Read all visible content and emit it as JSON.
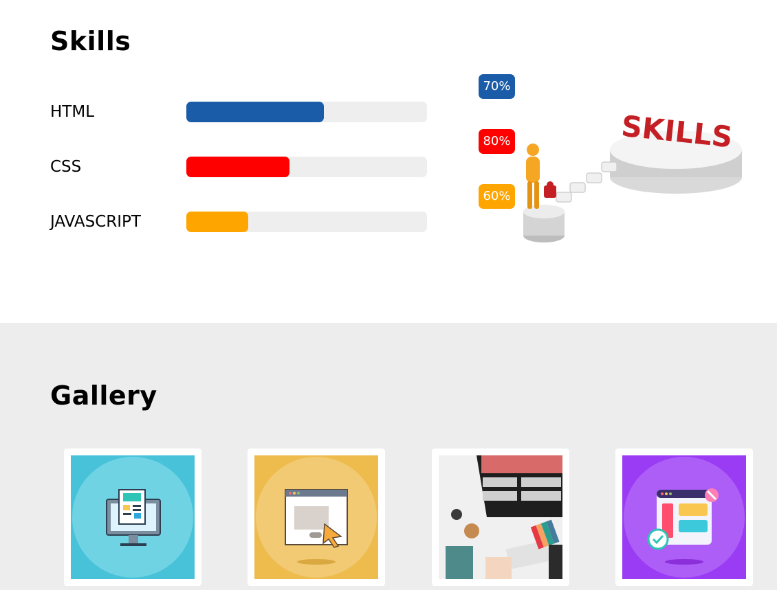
{
  "skills": {
    "title": "Skills",
    "items": [
      {
        "label": "HTML",
        "percent_label": "70%",
        "percent": 70,
        "color": "#1a5ca8"
      },
      {
        "label": "CSS",
        "percent_label": "80%",
        "percent": 80,
        "color": "#ff0000"
      },
      {
        "label": "JAVASCRIPT",
        "percent_label": "60%",
        "percent": 60,
        "color": "#ffa500"
      }
    ],
    "illustration_text": "SKILLS"
  },
  "gallery": {
    "title": "Gallery",
    "items": [
      {
        "icon": "monitor-newsletter-icon",
        "color": "#47c2d9"
      },
      {
        "icon": "browser-cursor-icon",
        "color": "#eebb4d"
      },
      {
        "icon": "designer-desk-photo",
        "color": "#e8e8e8"
      },
      {
        "icon": "web-app-dashboard-icon",
        "color": "#9b3cf5"
      }
    ]
  }
}
